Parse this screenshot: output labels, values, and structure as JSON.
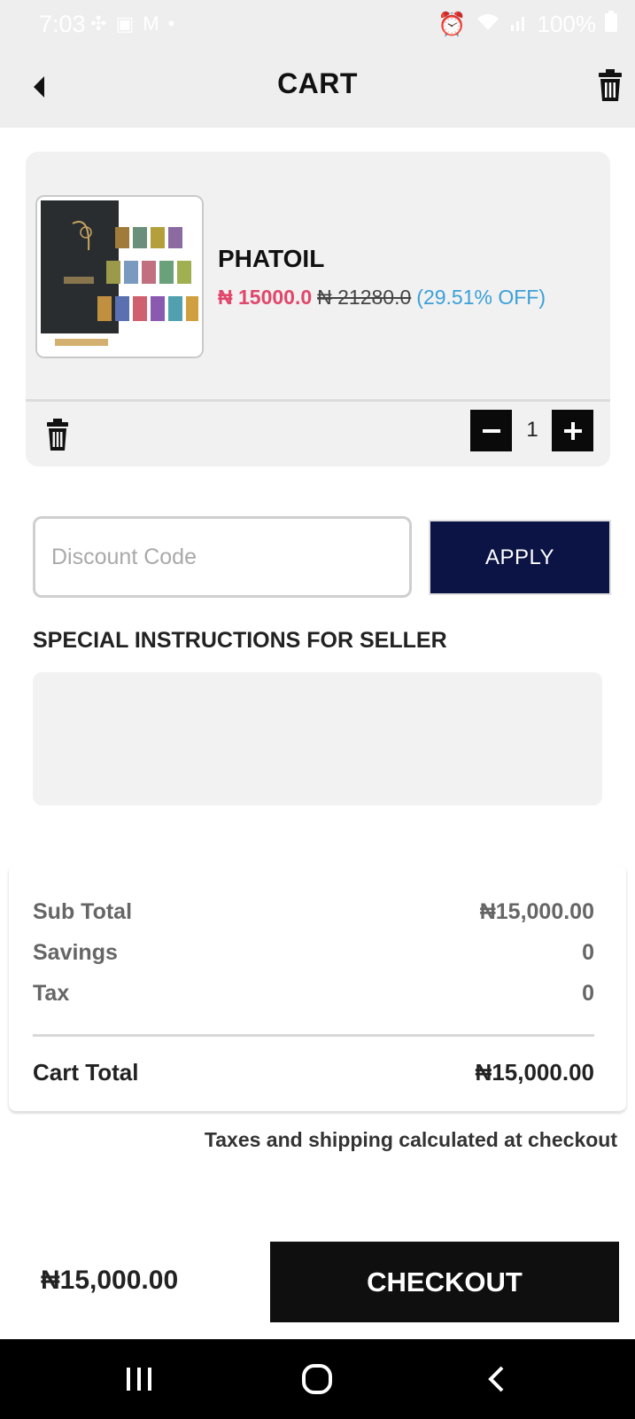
{
  "status_bar": {
    "time": "7:03",
    "battery": "100%"
  },
  "header": {
    "title": "CART"
  },
  "cart_item": {
    "name": "PHATOIL",
    "sale_price": "₦ 15000.0",
    "original_price": "₦ 21280.0",
    "discount": "(29.51% OFF)",
    "quantity": "1"
  },
  "discount": {
    "placeholder": "Discount Code",
    "apply_label": "APPLY"
  },
  "special_instructions": {
    "label": "SPECIAL INSTRUCTIONS FOR SELLER"
  },
  "summary": {
    "subtotal_label": "Sub Total",
    "subtotal_value": "₦15,000.00",
    "savings_label": "Savings",
    "savings_value": "0",
    "tax_label": "Tax",
    "tax_value": "0",
    "cart_total_label": "Cart Total",
    "cart_total_value": "₦15,000.00",
    "note": "Taxes and shipping calculated at checkout"
  },
  "footer": {
    "total": "₦15,000.00",
    "checkout_label": "CHECKOUT"
  },
  "colors": {
    "sale_price": "#e0476b",
    "discount_text": "#3aa0d8",
    "apply_button": "#0b1445",
    "checkout_button": "#0f0f0f"
  }
}
